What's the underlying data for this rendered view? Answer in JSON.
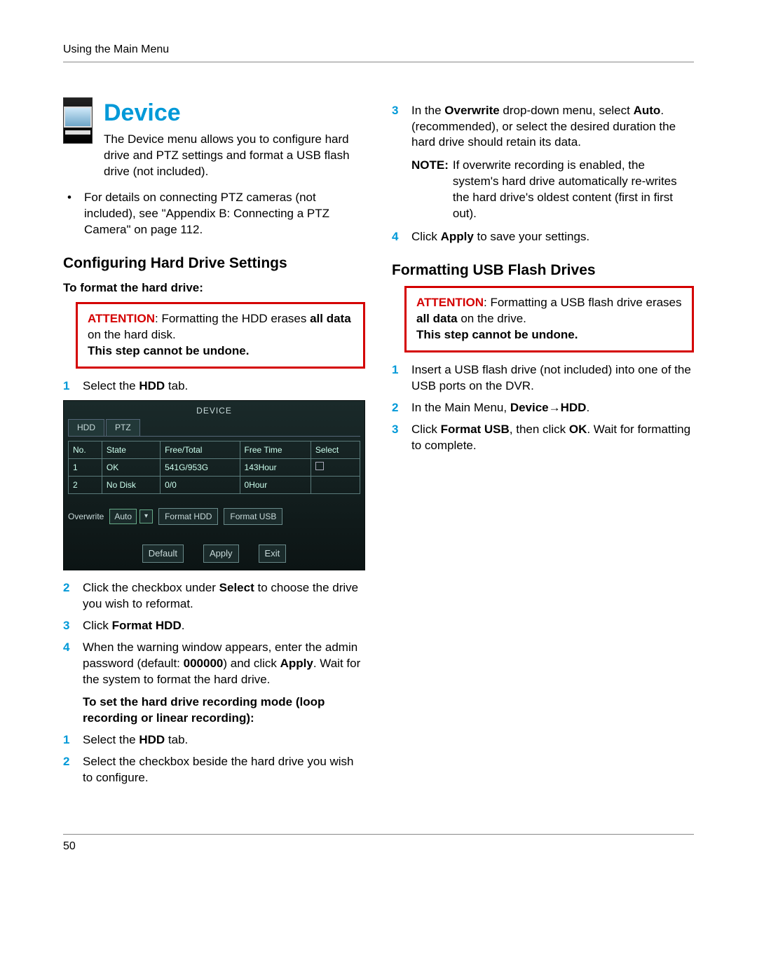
{
  "header": {
    "breadcrumb": "Using the Main Menu"
  },
  "footer": {
    "page_number": "50"
  },
  "left": {
    "title": "Device",
    "intro": "The Device menu allows you to configure hard drive and PTZ settings and format a USB flash drive (not included).",
    "bullet1": "For details on connecting PTZ cameras (not included), see \"Appendix B: Connecting a PTZ Camera\" on page 112.",
    "section1_title": "Configuring Hard Drive Settings",
    "format_label": "To format the hard drive:",
    "attention1_pre": "ATTENTION",
    "attention1_text": ": Formatting the HDD erases ",
    "attention1_bold": "all data",
    "attention1_post": " on the hard disk.",
    "attention1_final": "This step cannot be undone.",
    "steps_a": {
      "s1_pre": "Select the ",
      "s1_bold": "HDD",
      "s1_post": " tab.",
      "s2_pre": "Click the checkbox under ",
      "s2_bold": "Select",
      "s2_post": " to choose the drive you wish to reformat.",
      "s3_pre": "Click ",
      "s3_bold": "Format HDD",
      "s3_post": ".",
      "s4_pre": "When the warning window appears, enter the admin password (default: ",
      "s4_bold": "000000",
      "s4_mid": ") and click ",
      "s4_bold2": "Apply",
      "s4_post": ". Wait for the system to format the hard drive."
    },
    "mode_label": "To set the hard drive recording mode (loop recording or linear recording):",
    "steps_b": {
      "s1_pre": "Select the ",
      "s1_bold": "HDD",
      "s1_post": " tab.",
      "s2": "Select the checkbox beside the hard drive you wish to configure."
    },
    "dvr": {
      "title": "DEVICE",
      "tab1": "HDD",
      "tab2": "PTZ",
      "head_no": "No.",
      "head_state": "State",
      "head_free": "Free/Total",
      "head_time": "Free Time",
      "head_select": "Select",
      "r1_no": "1",
      "r1_state": "OK",
      "r1_free": "541G/953G",
      "r1_time": "143Hour",
      "r2_no": "2",
      "r2_state": "No Disk",
      "r2_free": "0/0",
      "r2_time": "0Hour",
      "overwrite_label": "Overwrite",
      "overwrite_val": "Auto",
      "btn_format_hdd": "Format HDD",
      "btn_format_usb": "Format USB",
      "btn_default": "Default",
      "btn_apply": "Apply",
      "btn_exit": "Exit"
    }
  },
  "right": {
    "s3_pre": "In the ",
    "s3_bold1": "Overwrite",
    "s3_mid1": " drop-down menu, select ",
    "s3_bold2": "Auto",
    "s3_post": ". (recommended), or select the desired duration the hard drive should retain its data.",
    "note_label": "NOTE:",
    "note_text": "If overwrite recording is enabled, the system's hard drive automatically re-writes the hard drive's oldest content (first in first out).",
    "s4_pre": "Click ",
    "s4_bold": "Apply",
    "s4_post": " to save your settings.",
    "section2_title": "Formatting USB Flash Drives",
    "attention2_pre": "ATTENTION",
    "attention2_text": ": Formatting a USB flash drive erases ",
    "attention2_bold": "all data",
    "attention2_post": " on the drive.",
    "attention2_final": "This step cannot be undone.",
    "usb_steps": {
      "s1": "Insert a USB flash drive (not included) into one of the USB ports on the DVR.",
      "s2_pre": "In the Main Menu, ",
      "s2_bold": "Device→HDD",
      "s2_post": ".",
      "s3_pre": "Click ",
      "s3_bold1": "Format USB",
      "s3_mid": ", then click ",
      "s3_bold2": "OK",
      "s3_post": ". Wait for formatting to complete."
    }
  }
}
